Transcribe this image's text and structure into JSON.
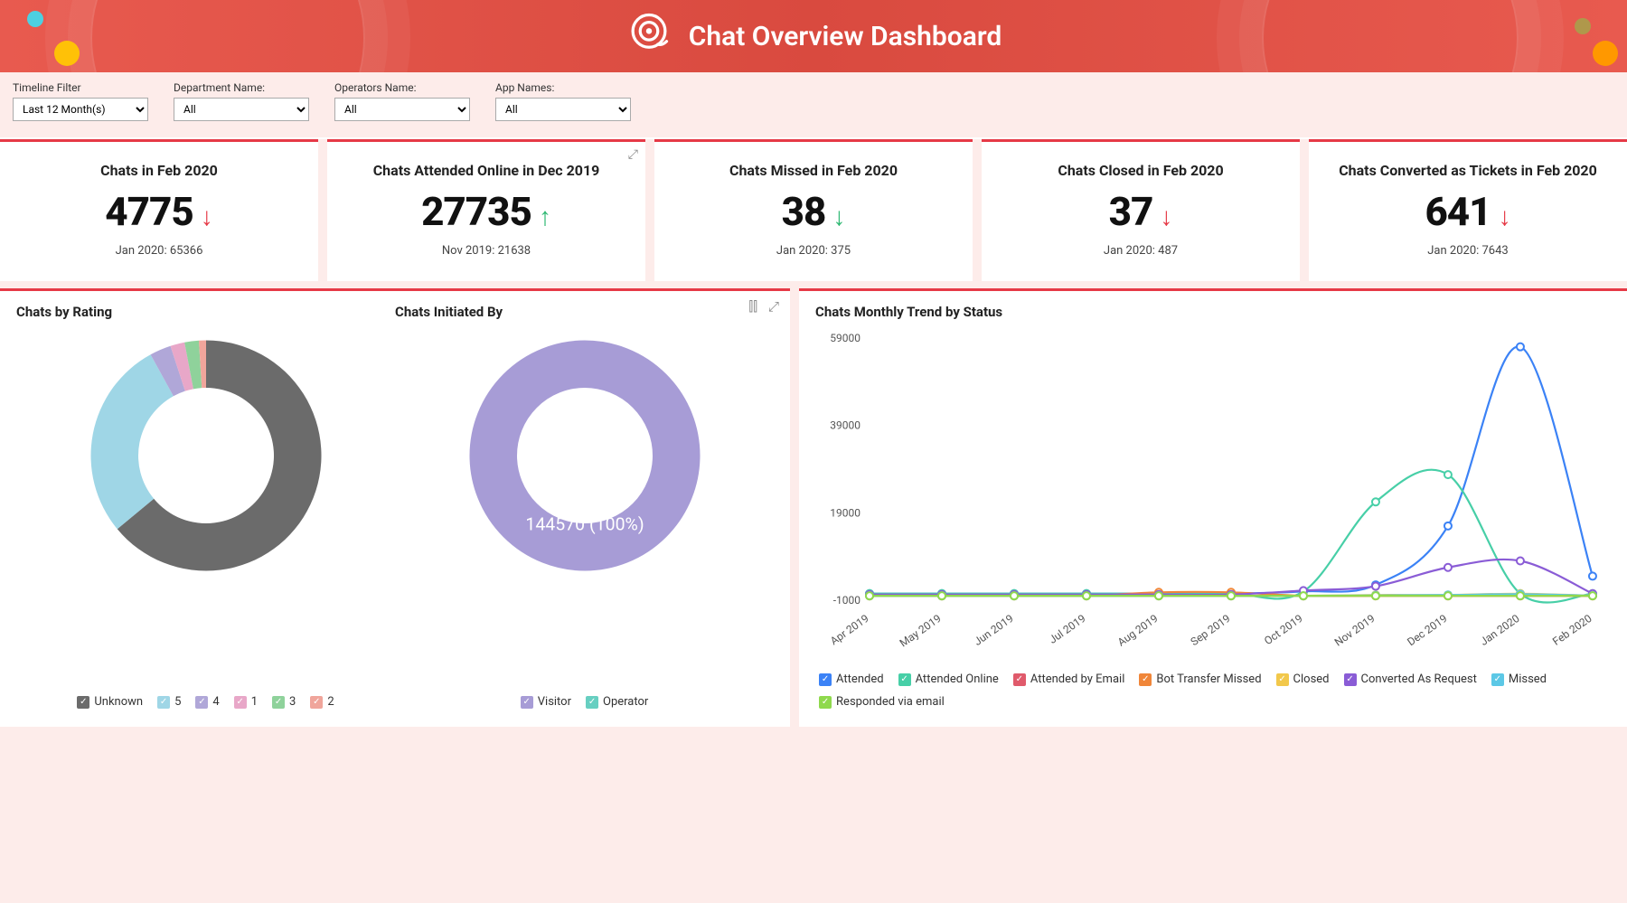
{
  "header": {
    "title": "Chat Overview Dashboard"
  },
  "filters": {
    "timeline": {
      "label": "Timeline Filter",
      "value": "Last 12 Month(s)"
    },
    "department": {
      "label": "Department Name:",
      "value": "All"
    },
    "operators": {
      "label": "Operators Name:",
      "value": "All"
    },
    "apps": {
      "label": "App Names:",
      "value": "All"
    }
  },
  "kpis": [
    {
      "title": "Chats in Feb 2020",
      "value": "4775",
      "arrow": "↓",
      "arrow_class": "down",
      "compare": "Jan 2020: 65366"
    },
    {
      "title": "Chats Attended Online in Dec 2019",
      "value": "27735",
      "arrow": "↑",
      "arrow_class": "up",
      "compare": "Nov 2019: 21638"
    },
    {
      "title": "Chats Missed in Feb 2020",
      "value": "38",
      "arrow": "↓",
      "arrow_class": "up",
      "compare": "Jan 2020: 375"
    },
    {
      "title": "Chats Closed in Feb 2020",
      "value": "37",
      "arrow": "↓",
      "arrow_class": "down",
      "compare": "Jan 2020: 487"
    },
    {
      "title": "Chats Converted as Tickets in Feb 2020",
      "value": "641",
      "arrow": "↓",
      "arrow_class": "down",
      "compare": "Jan 2020: 7643"
    }
  ],
  "panels": {
    "rating": {
      "title": "Chats by Rating"
    },
    "initiated": {
      "title": "Chats Initiated By",
      "center_label": "144570 (100%)"
    },
    "trend": {
      "title": "Chats Monthly Trend by Status"
    }
  },
  "legend_rating": [
    {
      "label": "Unknown",
      "color": "#6b6b6b"
    },
    {
      "label": "5",
      "color": "#9fd6e6"
    },
    {
      "label": "4",
      "color": "#b0a7d8"
    },
    {
      "label": "1",
      "color": "#e8a7c8"
    },
    {
      "label": "3",
      "color": "#8fd29b"
    },
    {
      "label": "2",
      "color": "#f0a59b"
    }
  ],
  "legend_initiated": [
    {
      "label": "Visitor",
      "color": "#a79cd6"
    },
    {
      "label": "Operator",
      "color": "#67cfc1"
    }
  ],
  "legend_trend": [
    {
      "label": "Attended",
      "color": "#3b82f6"
    },
    {
      "label": "Attended Online",
      "color": "#47cfa7"
    },
    {
      "label": "Attended by Email",
      "color": "#e05a6b"
    },
    {
      "label": "Bot Transfer Missed",
      "color": "#f08639"
    },
    {
      "label": "Closed",
      "color": "#f2c84b"
    },
    {
      "label": "Converted As Request",
      "color": "#8a5cd6"
    },
    {
      "label": "Missed",
      "color": "#5cc8e6"
    },
    {
      "label": "Responded via email",
      "color": "#8fd94d"
    }
  ],
  "chart_data": [
    {
      "type": "pie",
      "title": "Chats by Rating",
      "slices": [
        {
          "name": "Unknown",
          "value": 64,
          "color": "#6b6b6b"
        },
        {
          "name": "5",
          "value": 28,
          "color": "#9fd6e6"
        },
        {
          "name": "4",
          "value": 3,
          "color": "#b0a7d8"
        },
        {
          "name": "1",
          "value": 2,
          "color": "#e8a7c8"
        },
        {
          "name": "3",
          "value": 2,
          "color": "#8fd29b"
        },
        {
          "name": "2",
          "value": 1,
          "color": "#f0a59b"
        }
      ]
    },
    {
      "type": "pie",
      "title": "Chats Initiated By",
      "total": 144570,
      "slices": [
        {
          "name": "Visitor",
          "value": 144570,
          "percent": 100,
          "color": "#a79cd6"
        },
        {
          "name": "Operator",
          "value": 0,
          "percent": 0,
          "color": "#67cfc1"
        }
      ]
    },
    {
      "type": "line",
      "title": "Chats Monthly Trend by Status",
      "x": [
        "Apr 2019",
        "May 2019",
        "Jun 2019",
        "Jul 2019",
        "Aug 2019",
        "Sep 2019",
        "Oct 2019",
        "Nov 2019",
        "Dec 2019",
        "Jan 2020",
        "Feb 2020"
      ],
      "ylim": [
        -1000,
        59000
      ],
      "yticks": [
        -1000,
        19000,
        39000,
        59000
      ],
      "series": [
        {
          "name": "Attended",
          "color": "#3b82f6",
          "values": [
            500,
            500,
            500,
            500,
            500,
            500,
            1000,
            2500,
            16000,
            57000,
            4500
          ]
        },
        {
          "name": "Attended Online",
          "color": "#47cfa7",
          "values": [
            500,
            500,
            500,
            500,
            500,
            500,
            1000,
            21500,
            27735,
            500,
            500
          ]
        },
        {
          "name": "Attended by Email",
          "color": "#e05a6b",
          "values": [
            0,
            0,
            0,
            0,
            0,
            0,
            0,
            0,
            0,
            0,
            0
          ]
        },
        {
          "name": "Bot Transfer Missed",
          "color": "#f08639",
          "values": [
            0,
            0,
            0,
            0,
            800,
            800,
            0,
            0,
            0,
            0,
            0
          ]
        },
        {
          "name": "Closed",
          "color": "#f2c84b",
          "values": [
            0,
            0,
            0,
            0,
            0,
            0,
            0,
            200,
            200,
            487,
            37
          ]
        },
        {
          "name": "Converted As Request",
          "color": "#8a5cd6",
          "values": [
            300,
            300,
            300,
            300,
            300,
            300,
            1200,
            2200,
            6500,
            8000,
            500
          ]
        },
        {
          "name": "Missed",
          "color": "#5cc8e6",
          "values": [
            0,
            0,
            0,
            0,
            0,
            0,
            0,
            100,
            200,
            375,
            38
          ]
        },
        {
          "name": "Responded via email",
          "color": "#8fd94d",
          "values": [
            0,
            0,
            0,
            0,
            0,
            0,
            0,
            0,
            0,
            0,
            0
          ]
        }
      ]
    }
  ]
}
